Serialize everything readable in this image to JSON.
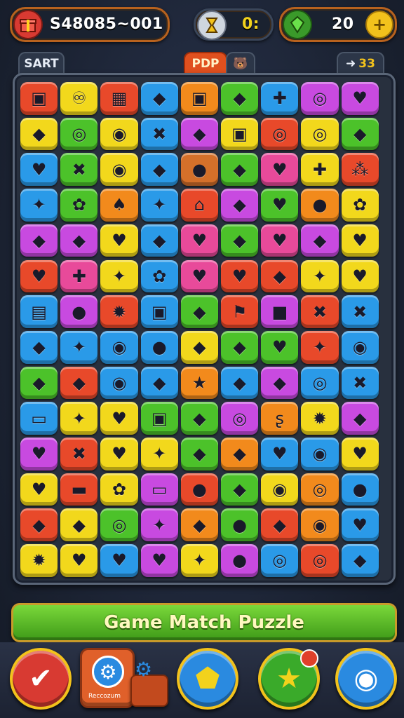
{
  "hud": {
    "score": "S48085~001",
    "timer": "0:",
    "gems": "20",
    "score_icon": "gift-box-icon",
    "timer_icon": "hourglass-icon",
    "gems_icon": "green-gem-icon",
    "add_icon": "plus-icon"
  },
  "tabs": {
    "start": "SART",
    "pop": "PDP",
    "level": "33"
  },
  "title": "Game Match Puzzle",
  "bottom_nav": {
    "shop_label": "Reccozum",
    "buttons": [
      "check-icon",
      "gear-icon",
      "shield-icon",
      "star-icon",
      "profile-icon"
    ]
  },
  "board": {
    "columns": 9,
    "rows": 14,
    "colors": {
      "R": "#e8492a",
      "O": "#f28a1c",
      "Y": "#f2d81c",
      "G": "#4cc22a",
      "B": "#2a9ae8",
      "P": "#c84ae0",
      "K": "#e84a9a",
      "N": "#d4702a"
    },
    "tiles": [
      [
        "R",
        "Y",
        "R",
        "B",
        "O",
        "G",
        "B",
        "P",
        "P"
      ],
      [
        "Y",
        "G",
        "Y",
        "B",
        "P",
        "Y",
        "R",
        "Y",
        "G"
      ],
      [
        "B",
        "G",
        "Y",
        "B",
        "N",
        "G",
        "K",
        "Y",
        "R"
      ],
      [
        "B",
        "G",
        "O",
        "B",
        "R",
        "P",
        "G",
        "O",
        "Y"
      ],
      [
        "P",
        "P",
        "Y",
        "B",
        "K",
        "G",
        "K",
        "P",
        "Y"
      ],
      [
        "R",
        "K",
        "Y",
        "B",
        "K",
        "R",
        "R",
        "Y",
        "Y"
      ],
      [
        "B",
        "P",
        "R",
        "B",
        "G",
        "R",
        "P",
        "R",
        "B"
      ],
      [
        "B",
        "B",
        "B",
        "B",
        "Y",
        "G",
        "G",
        "R",
        "B"
      ],
      [
        "G",
        "R",
        "B",
        "B",
        "O",
        "B",
        "P",
        "B",
        "B"
      ],
      [
        "B",
        "Y",
        "Y",
        "G",
        "G",
        "P",
        "O",
        "Y",
        "P"
      ],
      [
        "P",
        "R",
        "Y",
        "Y",
        "G",
        "O",
        "B",
        "B",
        "Y"
      ],
      [
        "Y",
        "R",
        "Y",
        "P",
        "R",
        "G",
        "Y",
        "O",
        "B"
      ],
      [
        "R",
        "Y",
        "G",
        "P",
        "O",
        "G",
        "R",
        "O",
        "B"
      ],
      [
        "Y",
        "Y",
        "B",
        "P",
        "Y",
        "P",
        "B",
        "R",
        "B"
      ]
    ],
    "symbols": [
      [
        "▣",
        "♾",
        "▦",
        "◆",
        "▣",
        "◆",
        "✚",
        "◎",
        "♥"
      ],
      [
        "◆",
        "◎",
        "◉",
        "✖",
        "◆",
        "▣",
        "◎",
        "◎",
        "◆"
      ],
      [
        "♥",
        "✖",
        "◉",
        "◆",
        "●",
        "◆",
        "♥",
        "✚",
        "⁂"
      ],
      [
        "✦",
        "✿",
        "♠",
        "✦",
        "⌂",
        "◆",
        "♥",
        "●",
        "✿"
      ],
      [
        "◆",
        "◆",
        "♥",
        "◆",
        "♥",
        "◆",
        "♥",
        "◆",
        "♥"
      ],
      [
        "♥",
        "✚",
        "✦",
        "✿",
        "♥",
        "♥",
        "◆",
        "✦",
        "♥"
      ],
      [
        "▤",
        "●",
        "✹",
        "▣",
        "◆",
        "⚑",
        "■",
        "✖",
        "✖"
      ],
      [
        "◆",
        "✦",
        "◉",
        "●",
        "◆",
        "◆",
        "♥",
        "✦",
        "◉"
      ],
      [
        "◆",
        "◆",
        "◉",
        "◆",
        "★",
        "◆",
        "◆",
        "◎",
        "✖"
      ],
      [
        "▭",
        "✦",
        "♥",
        "▣",
        "◆",
        "◎",
        "ʂ",
        "✹",
        "◆"
      ],
      [
        "♥",
        "✖",
        "♥",
        "✦",
        "◆",
        "◆",
        "♥",
        "◉",
        "♥"
      ],
      [
        "♥",
        "▬",
        "✿",
        "▭",
        "●",
        "◆",
        "◉",
        "◎",
        "●"
      ],
      [
        "◆",
        "◆",
        "◎",
        "✦",
        "◆",
        "●",
        "◆",
        "◉",
        "♥"
      ],
      [
        "✹",
        "♥",
        "♥",
        "♥",
        "✦",
        "●",
        "◎",
        "◎",
        "◆"
      ]
    ]
  }
}
